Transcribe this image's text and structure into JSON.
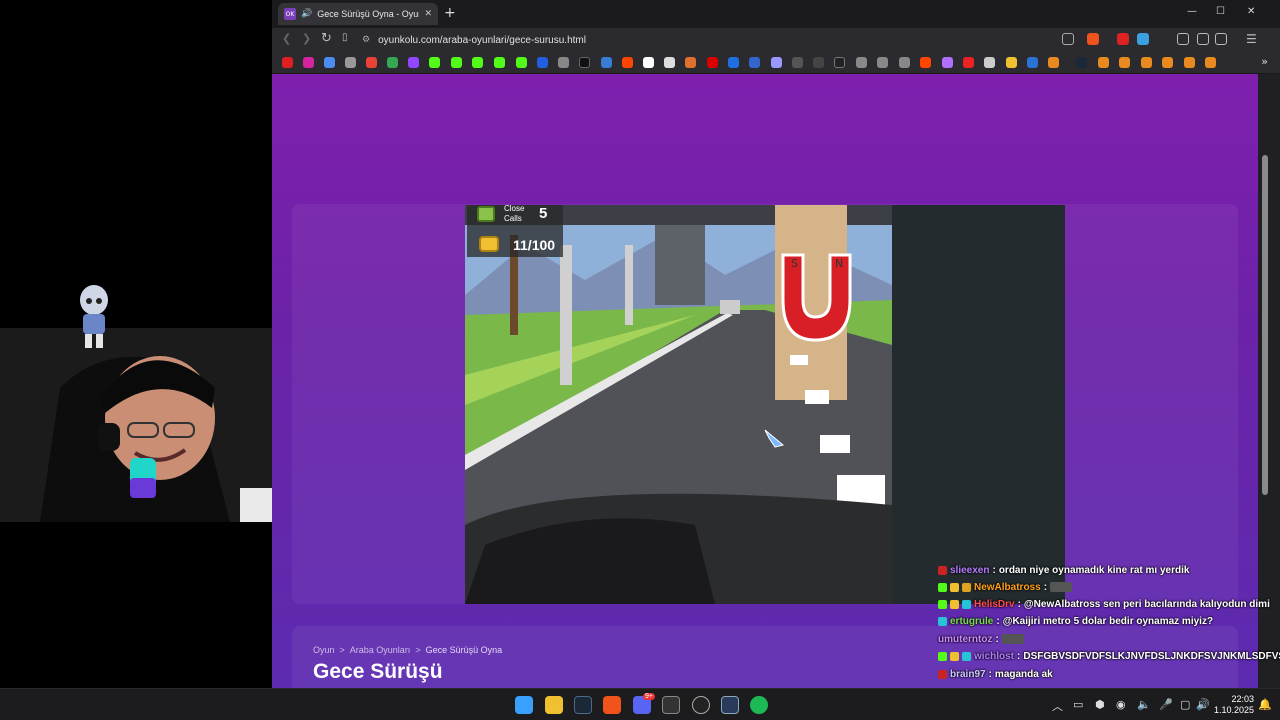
{
  "browser": {
    "tab": {
      "favicon_text": "OK",
      "title": "Gece Sürüşü Oyna - Oyun Kolu",
      "audio_icon": "speaker-icon",
      "close": "✕"
    },
    "new_tab": "+",
    "window_controls": {
      "minimize": "—",
      "maximize": "☐",
      "close": "✕"
    },
    "nav": {
      "back": "❮",
      "forward": "❯",
      "reload": "↻",
      "bookmark": "🔖"
    },
    "url": "oyunkolu.com/araba-oyunlari/gece-surusu.html",
    "url_icon": "site-info-icon",
    "bookmarks_more": "»"
  },
  "page": {
    "breadcrumb": [
      "Oyun",
      "Araba Oyunları",
      "Gece Sürüşü Oyna"
    ],
    "breadcrumb_sep": ">",
    "title": "Gece Sürüşü"
  },
  "game": {
    "close_calls_label": "Close Calls",
    "close_calls_value": "5",
    "coins": "11/100",
    "magnet_labels": [
      "S",
      "N"
    ]
  },
  "chat": [
    {
      "user": "slieexen",
      "user_color": "#b57cff",
      "sep": ":",
      "message": "ordan niye oynamadık kine rat mı yerdik"
    },
    {
      "user": "NewAlbatross",
      "user_color": "#ff9f1c",
      "sep": ":",
      "message": ""
    },
    {
      "user": "HelisDrv",
      "user_color": "#ff4d4d",
      "sep": ":",
      "message": "@NewAlbatross sen peri bacılarında kalıyodun dimi"
    },
    {
      "user": "ertugrule",
      "user_color": "#7ddc4f",
      "sep": ":",
      "message": "@Kaijiri metro 5 dolar bedir oynamaz miyiz?"
    },
    {
      "user": "umuterntoz",
      "user_color": "#c98bff",
      "sep": ":",
      "message": ""
    },
    {
      "user": "wichlost",
      "user_color": "#b57cff",
      "sep": ":",
      "message": "DSFGBVSDFVDFSLKJNVFDSLJNKDFSVJNKMLSDFVSDF"
    },
    {
      "user": "brain97",
      "user_color": "#d0c8ff",
      "sep": ":",
      "message": "maganda ak"
    }
  ],
  "taskbar": {
    "discord_badge": "9+",
    "clock_time": "22:03",
    "clock_date": "1.10.2025",
    "tray_chevron": "︿"
  }
}
